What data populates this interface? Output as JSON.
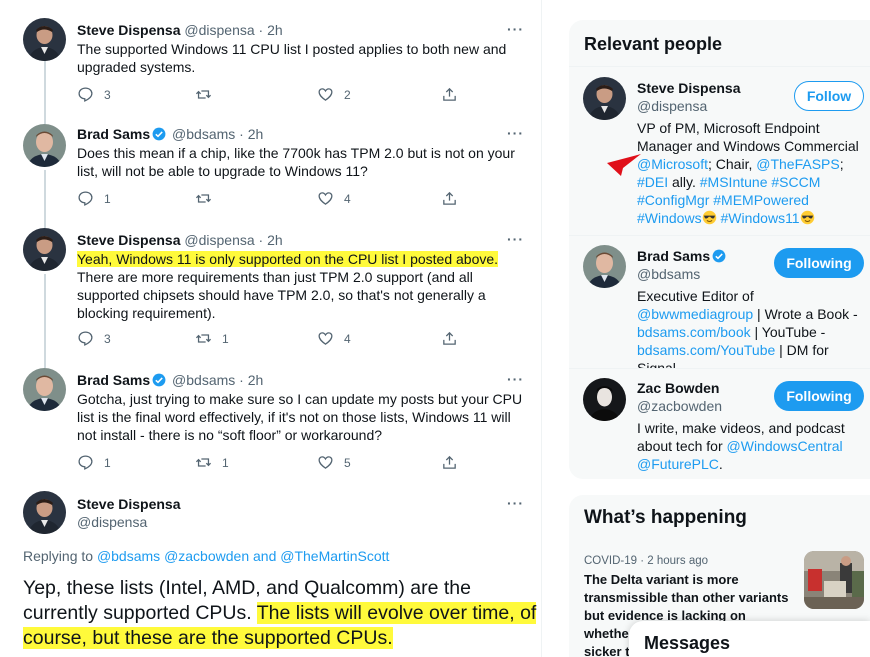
{
  "tweets": [
    {
      "name": "Steve Dispensa",
      "handle": "@dispensa",
      "time": "2h",
      "more": "···",
      "text": "The supported Windows 11 CPU list I posted applies to both new and upgraded systems.",
      "replies": "3",
      "retweets": "",
      "likes": "2"
    },
    {
      "name": "Brad Sams",
      "handle": "@bdsams",
      "time": "2h",
      "more": "···",
      "text": "Does this mean if a chip, like the 7700k has TPM 2.0 but is not on your list, will not be able to upgrade to Windows 11?",
      "replies": "1",
      "retweets": "",
      "likes": "4"
    },
    {
      "name": "Steve Dispensa",
      "handle": "@dispensa",
      "time": "2h",
      "more": "···",
      "text_highlight": "Yeah, Windows 11 is only supported on the CPU list I posted above.",
      "text_rest": " There are more requirements than just TPM 2.0 support (and all supported chipsets should have  TPM 2.0, so that's not generally a blocking requirement).",
      "replies": "3",
      "retweets": "1",
      "likes": "4"
    },
    {
      "name": "Brad Sams",
      "handle": "@bdsams",
      "time": "2h",
      "more": "···",
      "text": "Gotcha, just trying to make sure so I can update my posts but your CPU list is the final word effectively, if it's not on those lists, Windows 11 will not install - there is no “soft floor” or workaround?",
      "replies": "1",
      "retweets": "1",
      "likes": "5"
    },
    {
      "name": "Steve Dispensa",
      "handle": "@dispensa",
      "more": "···",
      "replying_prefix": "Replying to ",
      "replying_to_1": "@bdsams",
      "replying_to_2": "@zacbowden",
      "replying_and": " and ",
      "replying_to_3": "@TheMartinScott",
      "text_plain": "Yep, these lists (Intel, AMD, and Qualcomm) are the currently supported CPUs. ",
      "text_highlight": "The lists will evolve over time, of course, but these are the supported CPUs."
    }
  ],
  "time_separator": " · ",
  "sidebar": {
    "relevant_title": "Relevant people",
    "people": [
      {
        "name": "Steve Dispensa",
        "handle": "@dispensa",
        "button": "Follow",
        "bio_1": "VP of PM, Microsoft Endpoint Manager and Windows Commercial ",
        "bio_link_1": "@Microsoft",
        "bio_2": "; Chair, ",
        "bio_link_2": "@TheFASPS",
        "bio_3": "; ",
        "bio_link_3": "#DEI",
        "bio_4": " ally. ",
        "bio_link_4": "#MSIntune",
        "bio_link_5": "#SCCM",
        "bio_link_6": "#ConfigMgr",
        "bio_link_7": "#MEMPowered",
        "bio_link_8": "#Windows",
        "bio_link_9": "#Windows11"
      },
      {
        "name": "Brad Sams",
        "handle": "@bdsams",
        "button": "Following",
        "bio_1": "Executive Editor of ",
        "bio_link_1": "@bwwmediagroup",
        "bio_2": " | Wrote a Book - ",
        "bio_link_2": "bdsams.com/book",
        "bio_3": " | YouTube - ",
        "bio_link_3": "bdsams.com/YouTube",
        "bio_4": " | DM for Signal"
      },
      {
        "name": "Zac Bowden",
        "handle": "@zacbowden",
        "button": "Following",
        "bio_1": "I write, make videos, and podcast about tech for ",
        "bio_link_1": "@WindowsCentral",
        "bio_link_2": "@FuturePLC",
        "bio_end": "."
      }
    ],
    "whats_happening_title": "What’s happening",
    "trend": {
      "meta": "COVID-19 · 2 hours ago",
      "text": "The Delta variant is more transmissible than other variants but evidence is lacking on whethe",
      "text_cut": "sicker t"
    },
    "messages_title": "Messages"
  },
  "colors": {
    "accent": "#1d9bf0",
    "highlight": "#fffa3b",
    "annotation_arrow": "#e0101a"
  }
}
